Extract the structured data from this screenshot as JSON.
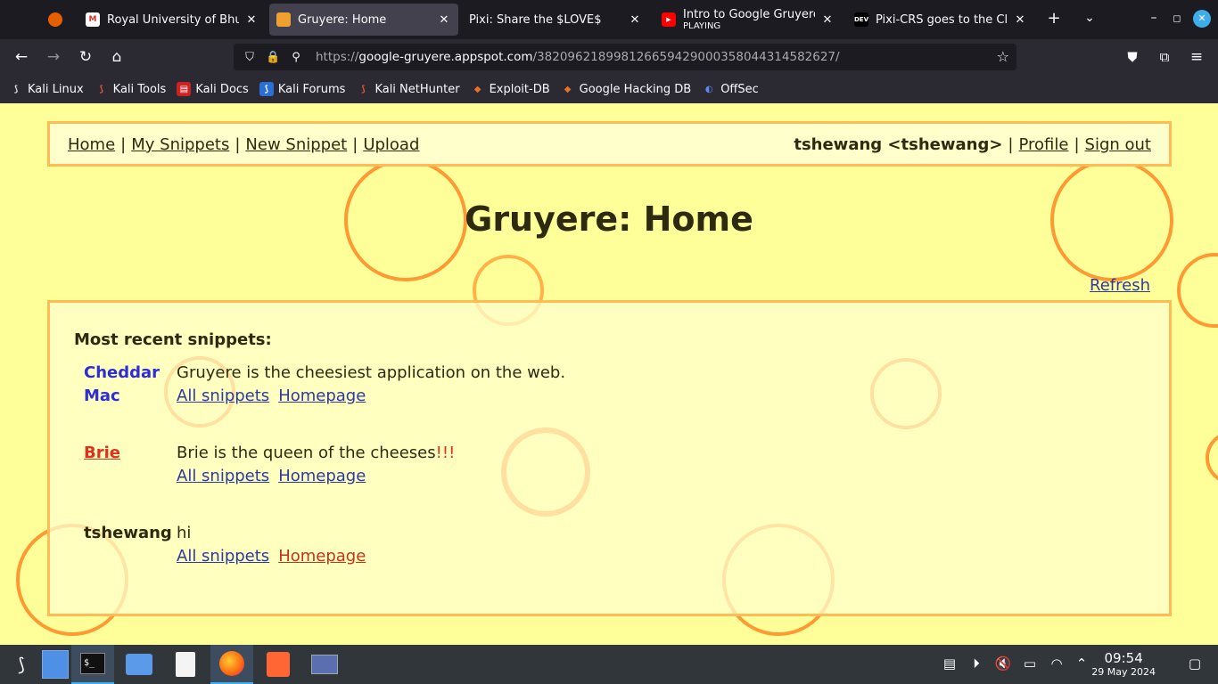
{
  "browser": {
    "tabs": [
      {
        "title": "Royal University of Bhuta",
        "sub": ""
      },
      {
        "title": "Gruyere: Home",
        "sub": ""
      },
      {
        "title": "Pixi: Share the $LOVE$",
        "sub": ""
      },
      {
        "title": "Intro to Google Gruyere -",
        "sub": "PLAYING"
      },
      {
        "title": "Pixi-CRS goes to the Clou",
        "sub": ""
      }
    ],
    "new_tab": "+",
    "url_scheme": "https://",
    "url_host": "google-gruyere.appspot.com",
    "url_path": "/382096218998126659429000358044314582627/",
    "bookmarks": [
      "Kali Linux",
      "Kali Tools",
      "Kali Docs",
      "Kali Forums",
      "Kali NetHunter",
      "Exploit-DB",
      "Google Hacking DB",
      "OffSec"
    ]
  },
  "page": {
    "menu": {
      "home": "Home",
      "my_snippets": "My Snippets",
      "new_snippet": "New Snippet",
      "upload": "Upload",
      "user": "tshewang <tshewang>",
      "profile": "Profile",
      "sign_out": "Sign out",
      "sep": "|"
    },
    "title": "Gruyere: Home",
    "refresh": "Refresh",
    "recent_heading": "Most recent snippets:",
    "snippets": [
      {
        "author_line1": "Cheddar",
        "author_line2": "Mac",
        "text": "Gruyere is the cheesiest application on the web.",
        "emph": "",
        "all": "All snippets",
        "home": "Homepage"
      },
      {
        "author_line1": "Brie",
        "author_line2": "",
        "text": "Brie is the queen of the cheeses",
        "emph": "!!!",
        "all": "All snippets",
        "home": "Homepage"
      },
      {
        "author_line1": "tshewang",
        "author_line2": "",
        "text": "hi",
        "emph": "",
        "all": "All snippets",
        "home": "Homepage"
      }
    ]
  },
  "taskbar": {
    "time": "09:54",
    "date": "29 May 2024"
  },
  "colors": {
    "page_bg": "#ffff99",
    "border": "#ffbb55",
    "link_blue": "#2e3a9e",
    "link_red": "#e0301e"
  }
}
